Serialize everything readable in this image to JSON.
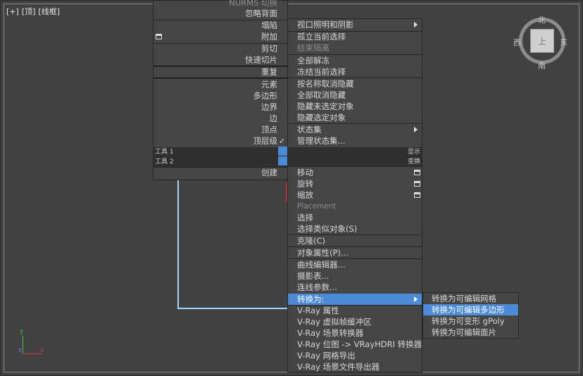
{
  "viewport": {
    "label_plus": "[+]",
    "label_view": "[顶]",
    "label_mode": "[线框]"
  },
  "viewcube": {
    "north": "北",
    "south": "南",
    "west": "西",
    "east": "东",
    "face": "上"
  },
  "axis": {
    "y": "y",
    "z": "z",
    "x": "x"
  },
  "quad_left": {
    "items": [
      {
        "label": "NURMS 切换",
        "disabled": true
      },
      {
        "label": "忽略背面"
      },
      {
        "label": "塌陷"
      },
      {
        "label": "附加",
        "icon": "box-icon"
      },
      {
        "label": "剪切"
      },
      {
        "label": "快速切片"
      },
      {
        "label": "重复"
      },
      {
        "label": "元素"
      },
      {
        "label": "多边形"
      },
      {
        "label": "边界"
      },
      {
        "label": "边"
      },
      {
        "label": "顶点"
      },
      {
        "label": "顶层级",
        "checked": true
      },
      {
        "label": "创建"
      }
    ],
    "tool1_left": "工具 1",
    "tool2_left": "工具 2",
    "check_mark": "✓"
  },
  "quad_right": {
    "items": [
      {
        "label": "视口照明和阴影",
        "submenu": true
      },
      {
        "label": "孤立当前选择"
      },
      {
        "label": "结束隔离",
        "disabled": true
      },
      {
        "label": "全部解冻"
      },
      {
        "label": "冻结当前选择"
      },
      {
        "label": "按名称取消隐藏"
      },
      {
        "label": "全部取消隐藏"
      },
      {
        "label": "隐藏未选定对象"
      },
      {
        "label": "隐藏选定对象"
      },
      {
        "label": "状态集",
        "submenu": true
      },
      {
        "label": "管理状态集..."
      }
    ],
    "tool1_right": "显示",
    "tool2_right": "变换"
  },
  "transform_menu": {
    "items": [
      {
        "label": "移动"
      },
      {
        "label": "旋转"
      },
      {
        "label": "缩放"
      },
      {
        "label": "Placement",
        "disabled": true
      },
      {
        "label": "选择"
      },
      {
        "label": "选择类似对象(S)"
      },
      {
        "label": "克隆(C)"
      },
      {
        "label": "对象属性(P)..."
      },
      {
        "label": "曲线编辑器..."
      },
      {
        "label": "摄影表..."
      },
      {
        "label": "连线参数..."
      },
      {
        "label": "转换为:",
        "highlighted": true,
        "submenu": true
      },
      {
        "label": "V-Ray 属性"
      },
      {
        "label": "V-Ray 虚拟帧缓冲区"
      },
      {
        "label": "V-Ray 场景转换器"
      },
      {
        "label": "V-Ray 位图 -> VRayHDRI 转换器"
      },
      {
        "label": "V-Ray 网格导出"
      },
      {
        "label": "V-Ray 场景文件导出器"
      }
    ]
  },
  "convert_submenu": {
    "items": [
      {
        "label": "转换为可编辑网格"
      },
      {
        "label": "转换为可编辑多边形",
        "highlighted": true
      },
      {
        "label": "转换为可变形 gPoly"
      },
      {
        "label": "转换为可编辑面片"
      }
    ]
  },
  "colors": {
    "highlight": "#4a8ad6",
    "spline": "#9fd9ff"
  }
}
